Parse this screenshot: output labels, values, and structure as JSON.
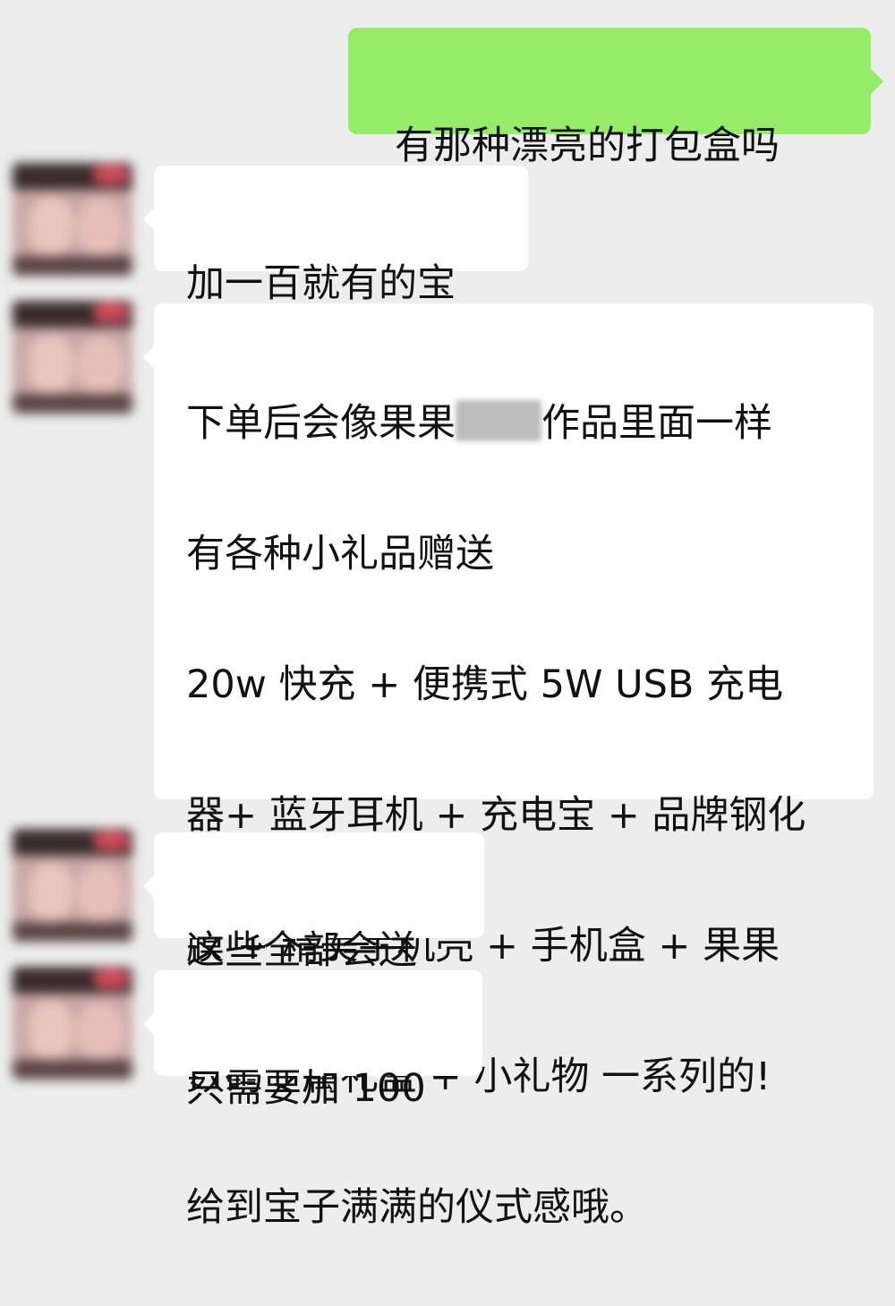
{
  "messages": [
    {
      "direction": "out",
      "text": "有那种漂亮的打包盒吗"
    },
    {
      "direction": "in",
      "text": "加一百就有的宝"
    },
    {
      "direction": "in",
      "lines": {
        "line1_before_redaction": "下单后会像果果",
        "line1_after_redaction": "作品里面一样",
        "line2": "有各种小礼品赠送",
        "line3": "20w 快充 + 便携式 5W USB 充电",
        "line4": "器+ 蓝牙耳机 + 充电宝 + 品牌钢化",
        "line5": "膜 + 精美手机壳 + 手机盒 + 果果",
        "line6": "数码专属礼盒 + 小礼物 一系列的!",
        "line7": "给到宝子满满的仪式感哦。"
      }
    },
    {
      "direction": "in",
      "text": "这些全部会送"
    },
    {
      "direction": "in",
      "text": "只需要加 100"
    }
  ],
  "colors": {
    "background": "#ededed",
    "outgoing_bubble": "#95ec69",
    "incoming_bubble": "#ffffff"
  }
}
